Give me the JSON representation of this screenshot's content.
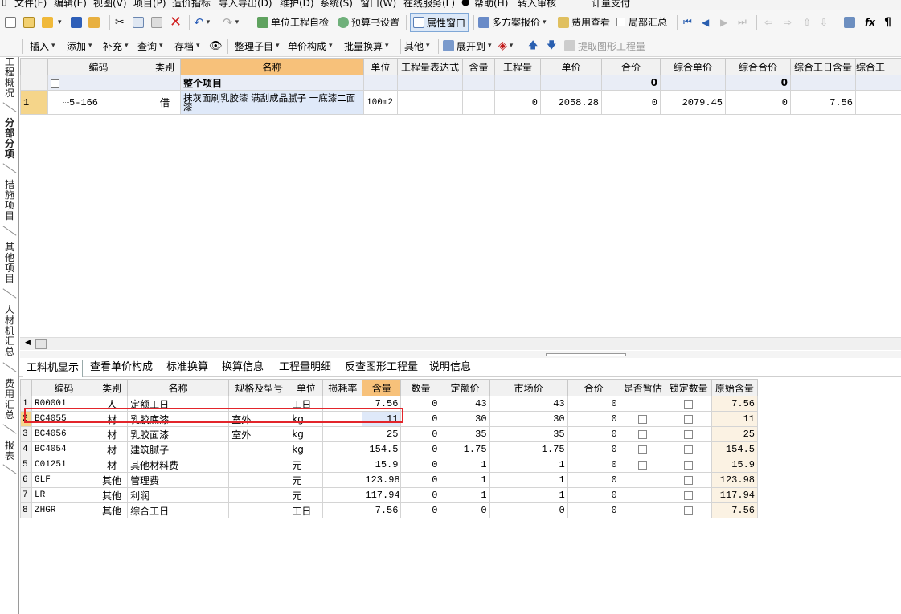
{
  "menu": [
    "文件(F)",
    "编辑(E)",
    "视图(V)",
    "项目(P)",
    "造价指标",
    "导入导出(D)",
    "维护(D)",
    "系统(S)",
    "窗口(W)",
    "在线服务(L)",
    "帮助(H)",
    "转入审核",
    "计量支付"
  ],
  "toolbar1": {
    "self_check": "单位工程自检",
    "budget_setting": "预算书设置",
    "property_window": "属性窗口",
    "multi_quote": "多方案报价",
    "fee_view": "费用查看",
    "partial_summary": "局部汇总",
    "fx": "fx",
    "para": "¶"
  },
  "toolbar2": {
    "insert": "插入",
    "add": "添加",
    "supplement": "补充",
    "query": "查询",
    "archive": "存档",
    "organize": "整理子目",
    "unit_price_comp": "单价构成",
    "batch_convert": "批量换算",
    "other": "其他",
    "expand": "展开到",
    "extract": "提取图形工程量"
  },
  "leftnav": [
    "工程概况",
    "分部分项",
    "措施项目",
    "其他项目",
    "人材机汇总",
    "费用汇总",
    "报表"
  ],
  "upper": {
    "headers": [
      "编码",
      "类别",
      "名称",
      "单位",
      "工程量表达式",
      "含量",
      "工程量",
      "单价",
      "合价",
      "综合单价",
      "综合合价",
      "综合工日含量",
      "综合工"
    ],
    "summary": {
      "name": "整个项目",
      "total": "0",
      "comp_total": "0"
    },
    "row": {
      "num": "1",
      "code": "5-166",
      "type": "借",
      "name": "抹灰面刷乳胶漆 满刮成品腻子 一底漆二面漆",
      "unit": "100m2",
      "expr": "",
      "content": "",
      "qty": "0",
      "price": "2058.28",
      "total": "0",
      "comp_price": "2079.45",
      "comp_total": "0",
      "labor": "7.56"
    }
  },
  "bottom_tabs": [
    "工料机显示",
    "查看单价构成",
    "标准换算",
    "换算信息",
    "工程量明细",
    "反查图形工程量",
    "说明信息"
  ],
  "lower": {
    "headers": [
      "编码",
      "类别",
      "名称",
      "规格及型号",
      "单位",
      "损耗率",
      "含量",
      "数量",
      "定额价",
      "市场价",
      "合价",
      "是否暂估",
      "锁定数量",
      "原始含量"
    ],
    "rows": [
      {
        "n": "1",
        "code": "R00001",
        "type": "人",
        "name": "定额工日",
        "spec": "",
        "unit": "工日",
        "loss": "",
        "content": "7.56",
        "qty": "0",
        "quota": "43",
        "market": "43",
        "total": "0",
        "est": false,
        "orig": "7.56"
      },
      {
        "n": "2",
        "code": "BC4055",
        "type": "材",
        "name": "乳胶底漆",
        "spec": "室外",
        "unit": "kg",
        "loss": "",
        "content": "11",
        "qty": "0",
        "quota": "30",
        "market": "30",
        "total": "0",
        "est": true,
        "orig": "11"
      },
      {
        "n": "3",
        "code": "BC4056",
        "type": "材",
        "name": "乳胶面漆",
        "spec": "室外",
        "unit": "kg",
        "loss": "",
        "content": "25",
        "qty": "0",
        "quota": "35",
        "market": "35",
        "total": "0",
        "est": true,
        "orig": "25"
      },
      {
        "n": "4",
        "code": "BC4054",
        "type": "材",
        "name": "建筑腻子",
        "spec": "",
        "unit": "kg",
        "loss": "",
        "content": "154.5",
        "qty": "0",
        "quota": "1.75",
        "market": "1.75",
        "total": "0",
        "est": true,
        "orig": "154.5"
      },
      {
        "n": "5",
        "code": "C01251",
        "type": "材",
        "name": "其他材料费",
        "spec": "",
        "unit": "元",
        "loss": "",
        "content": "15.9",
        "qty": "0",
        "quota": "1",
        "market": "1",
        "total": "0",
        "est": true,
        "orig": "15.9"
      },
      {
        "n": "6",
        "code": "GLF",
        "type": "其他",
        "name": "管理费",
        "spec": "",
        "unit": "元",
        "loss": "",
        "content": "123.98",
        "qty": "0",
        "quota": "1",
        "market": "1",
        "total": "0",
        "est": false,
        "orig": "123.98"
      },
      {
        "n": "7",
        "code": "LR",
        "type": "其他",
        "name": "利润",
        "spec": "",
        "unit": "元",
        "loss": "",
        "content": "117.94",
        "qty": "0",
        "quota": "1",
        "market": "1",
        "total": "0",
        "est": false,
        "orig": "117.94"
      },
      {
        "n": "8",
        "code": "ZHGR",
        "type": "其他",
        "name": "综合工日",
        "spec": "",
        "unit": "工日",
        "loss": "",
        "content": "7.56",
        "qty": "0",
        "quota": "0",
        "market": "0",
        "total": "0",
        "est": false,
        "orig": "7.56"
      }
    ]
  }
}
